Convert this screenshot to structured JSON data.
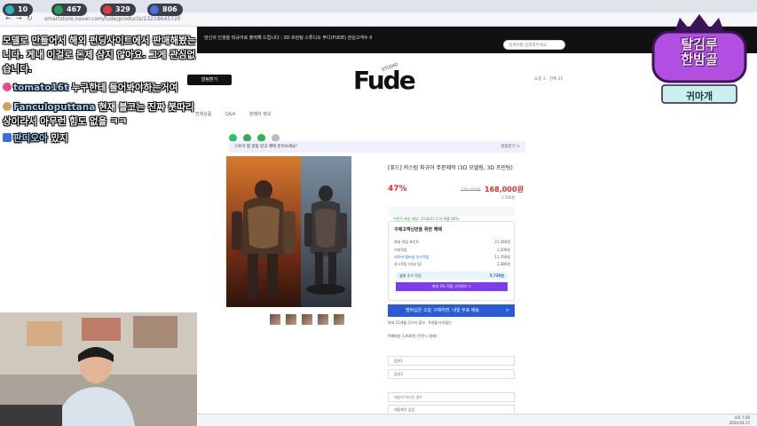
{
  "browser": {
    "url": "smartstore.naver.com/fude/products/13218645720",
    "nav_back": "←",
    "nav_forward": "→",
    "nav_reload": "↻"
  },
  "stream_stats": [
    {
      "icon": "viewer-icon",
      "value": "10",
      "color": "#2bb3c0"
    },
    {
      "icon": "follower-icon",
      "value": "467",
      "color": "#1fa35a"
    },
    {
      "icon": "youtube-icon",
      "value": "329",
      "color": "#e23b3b"
    },
    {
      "icon": "subscriber-icon",
      "value": "806",
      "color": "#4a6fe0"
    }
  ],
  "chat": {
    "line1": "모델로 만들어서 해외 펀딩사이트에서 판매해봤는",
    "line2": "니다. 게내 이걸로 돈제 삼지 않아요. 그게 관심없",
    "line3": "습니다.",
    "m1_user": "tomato16t",
    "m1_text": "누구한테 들어봐야하는거여",
    "m2_user": "Fanculoputtana",
    "m2_text": "현재 블코는 진짜 붓따리",
    "m2_cont": "상이라서 아무런 힘도 없을 ㅋㅋ",
    "m3_user": "판디오아",
    "m3_text": "밌지"
  },
  "site": {
    "notice": "당신의 인생을 피규어로 출력해 드립니다 : 3D 프린팅 스튜디오 푸디(FUDE)  관심고객수 0",
    "search_placeholder": "검색어를 입력해주세요",
    "logo": "Fude",
    "logo_sub": "STUDIO",
    "delivery_btn": "알림받기",
    "header_util": "쇼핑 3 · 전체 25",
    "categories": [
      "전체상품",
      "Q&A",
      "판매자 정보"
    ],
    "benefit_notice": "스토어 찜 알림 받고 혜택 받아보세요!",
    "benefit_notice_right": "알림받기 >"
  },
  "product": {
    "title": "[퓨드] 커스텀 피규어 주문제작 (3D 모델링, 3D 프린팅)",
    "discount": "47%",
    "original_price": "316,000원",
    "price": "168,000원",
    "point": "3,500원",
    "ship_notice": "이번주 배송 예상: 3/18(토) 도착 확률 80%",
    "benefit_title": "구매고객님만을 위한 혜택",
    "benefit_rows": [
      {
        "label": "최대 적립 포인트",
        "value": "21,460원"
      },
      {
        "label": "기본적립",
        "value": "1,500원"
      },
      {
        "label": "네이버 멤버십 추가적립",
        "value": "11,760원"
      },
      {
        "label": "상시적립 (리뷰 등)",
        "value": "2,380원"
      }
    ],
    "benefit_point_label": "월별 추가 적립",
    "benefit_point_value": "5,720원",
    "benefit_btn": "최대 5% 적립 시작하기 >",
    "promo": "멤버십은 오늘 구매하면, 내일 무료 배송",
    "promo_right": ">",
    "info_line": "최대 15개월 무이자 할부 · 6개월 다자할인",
    "info_line2": "택배배송 3,000원 (주문시 결제)",
    "options": [
      "옵션1",
      "옵션2",
      "대상이 하나인 경우",
      "제품제작 없음"
    ]
  },
  "channel": {
    "logo_text": "탈김루\n한밤골",
    "nick": "귀마개"
  },
  "taskbar": {
    "time": "오후 7:26",
    "date": "2024-03-17"
  }
}
